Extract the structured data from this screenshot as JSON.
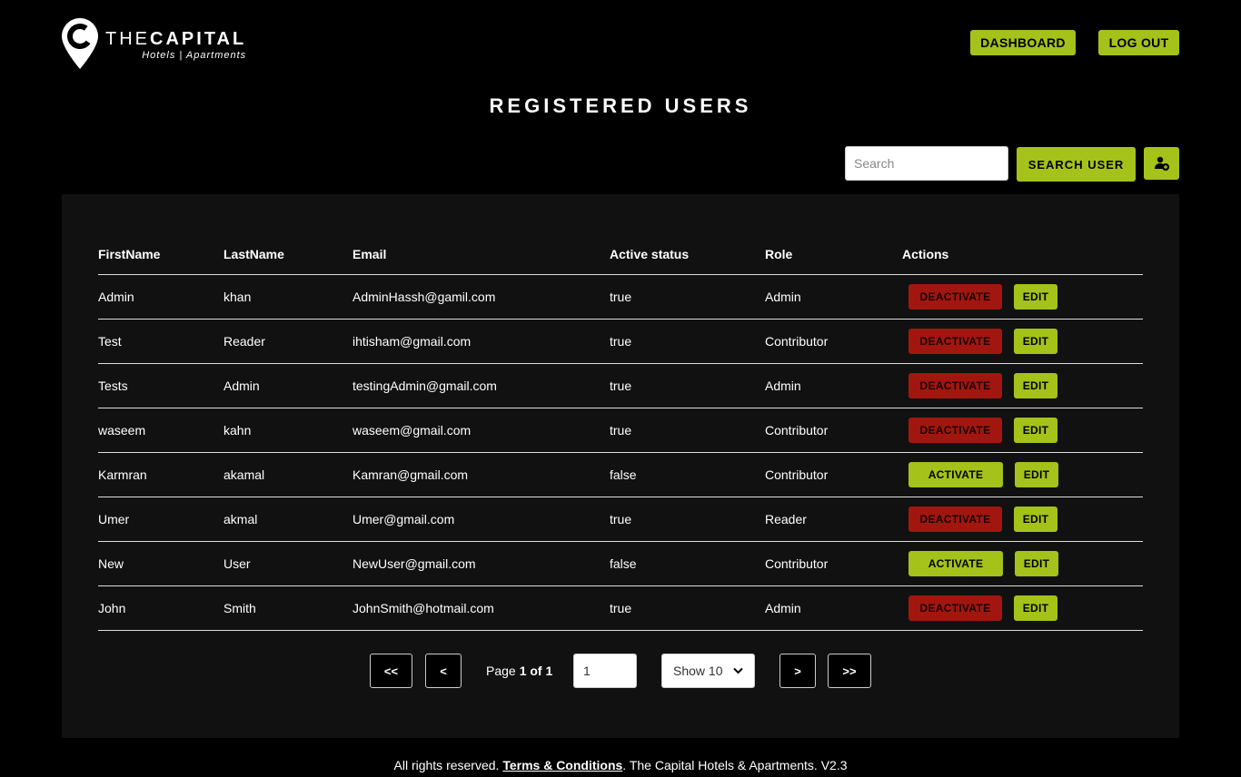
{
  "brand": {
    "title_thin": "THE",
    "title_bold": "CAPITAL",
    "subtitle": "Hotels | Apartments",
    "icon": "map-pin-icon"
  },
  "nav": {
    "dashboard_label": "DASHBOARD",
    "logout_label": "LOG OUT"
  },
  "page": {
    "title": "REGISTERED USERS"
  },
  "search": {
    "placeholder": "Search",
    "value": "",
    "button_label": "SEARCH USER",
    "add_user_icon": "add-user-icon"
  },
  "table": {
    "columns": [
      "FirstName",
      "LastName",
      "Email",
      "Active status",
      "Role",
      "Actions"
    ],
    "rows": [
      {
        "first": "Admin",
        "last": "khan",
        "email": "AdminHassh@gamil.com",
        "active": "true",
        "role": "Admin",
        "action": "DEACTIVATE",
        "edit": "EDIT"
      },
      {
        "first": "Test",
        "last": "Reader",
        "email": "ihtisham@gmail.com",
        "active": "true",
        "role": "Contributor",
        "action": "DEACTIVATE",
        "edit": "EDIT"
      },
      {
        "first": "Tests",
        "last": "Admin",
        "email": "testingAdmin@gmail.com",
        "active": "true",
        "role": "Admin",
        "action": "DEACTIVATE",
        "edit": "EDIT"
      },
      {
        "first": "waseem",
        "last": "kahn",
        "email": "waseem@gmail.com",
        "active": "true",
        "role": "Contributor",
        "action": "DEACTIVATE",
        "edit": "EDIT"
      },
      {
        "first": "Karmran",
        "last": "akamal",
        "email": "Kamran@gmail.com",
        "active": "false",
        "role": "Contributor",
        "action": "ACTIVATE",
        "edit": "EDIT"
      },
      {
        "first": "Umer",
        "last": "akmal",
        "email": "Umer@gmail.com",
        "active": "true",
        "role": "Reader",
        "action": "DEACTIVATE",
        "edit": "EDIT"
      },
      {
        "first": "New",
        "last": "User",
        "email": "NewUser@gmail.com",
        "active": "false",
        "role": "Contributor",
        "action": "ACTIVATE",
        "edit": "EDIT"
      },
      {
        "first": "John",
        "last": "Smith",
        "email": "JohnSmith@hotmail.com",
        "active": "true",
        "role": "Admin",
        "action": "DEACTIVATE",
        "edit": "EDIT"
      }
    ]
  },
  "pagination": {
    "first_label": "<<",
    "prev_label": "<",
    "page_word": "Page",
    "page_of": "1 of 1",
    "page_input_value": "1",
    "page_size_selected": "Show 10",
    "next_label": ">",
    "last_label": ">>"
  },
  "footer": {
    "prefix": "All rights reserved. ",
    "terms_label": "Terms & Conditions",
    "suffix": ". The Capital Hotels & Apartments. V2.3"
  },
  "colors": {
    "accent": "#a4c21a",
    "danger": "#a1170f",
    "background": "#000000",
    "panel": "#111111"
  }
}
